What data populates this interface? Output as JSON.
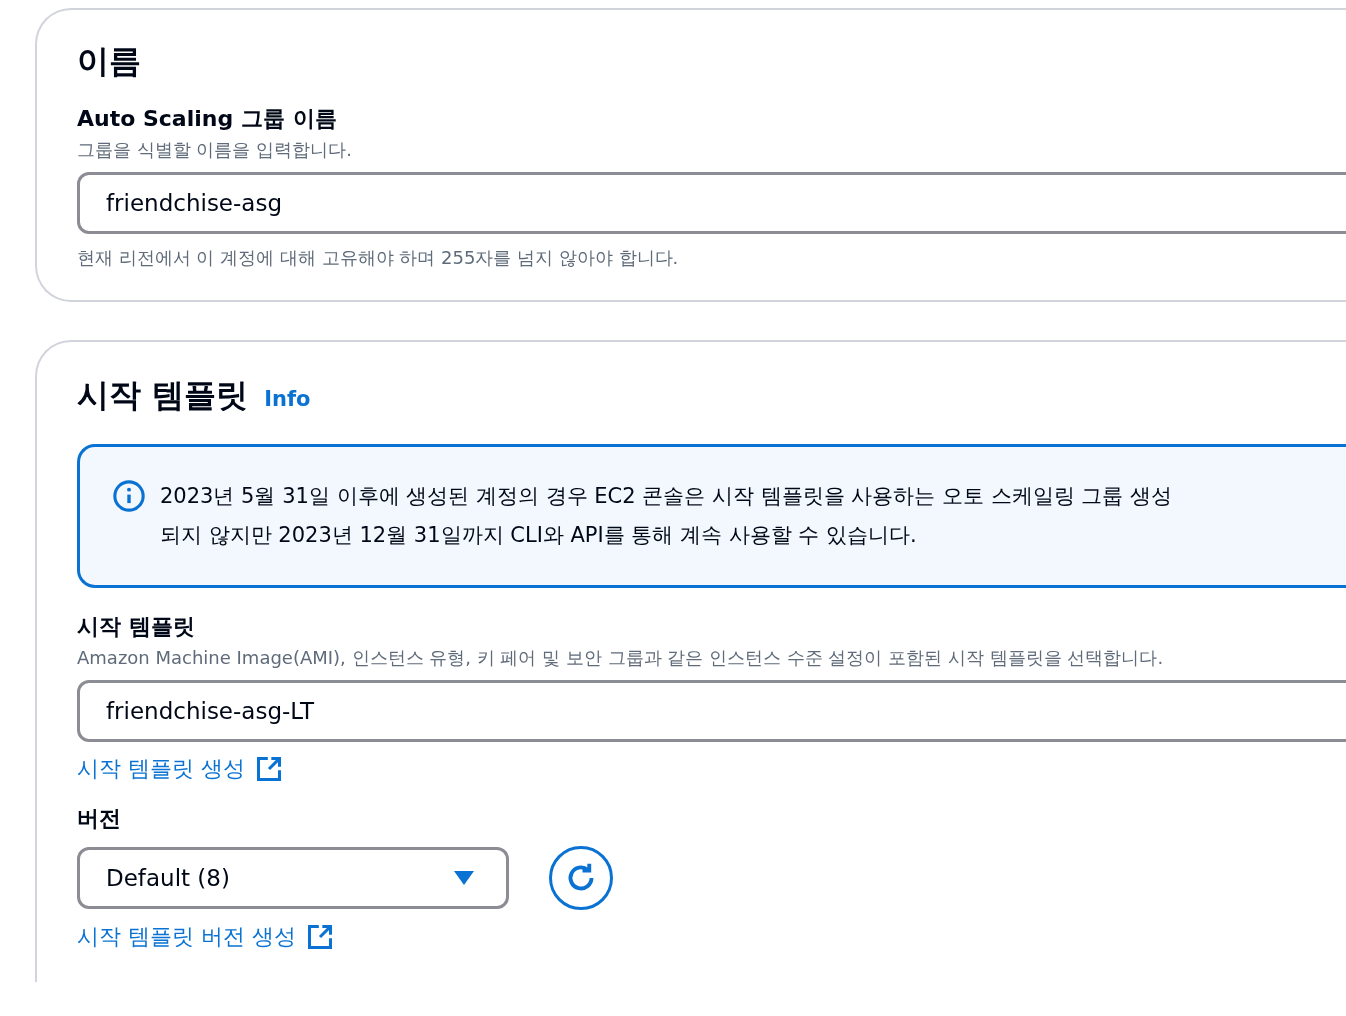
{
  "name_section": {
    "title": "이름",
    "field_label": "Auto Scaling 그룹 이름",
    "field_description": "그룹을 식별할 이름을 입력합니다.",
    "value": "friendchise-asg",
    "constraint": "현재 리전에서 이 계정에 대해 고유해야 하며 255자를 넘지 않아야 합니다."
  },
  "launch_template_section": {
    "title": "시작 템플릿",
    "info_link": "Info",
    "alert": {
      "lines": [
        "2023년 5월 31일 이후에 생성된 계정의 경우 EC2 콘솔은 시작 템플릿을 사용하는 오토 스케일링 그룹 생성",
        "되지 않지만 2023년 12월 31일까지 CLI와 API를 통해 계속 사용할 수 있습니다."
      ]
    },
    "field_label": "시작 템플릿",
    "field_description": "Amazon Machine Image(AMI), 인스턴스 유형, 키 페어 및 보안 그룹과 같은 인스턴스 수준 설정이 포함된 시작 템플릿을 선택합니다.",
    "value": "friendchise-asg-LT",
    "create_link": "시작 템플릿 생성",
    "version_label": "버전",
    "version_value": "Default (8)",
    "create_version_link": "시작 템플릿 버전 생성"
  }
}
